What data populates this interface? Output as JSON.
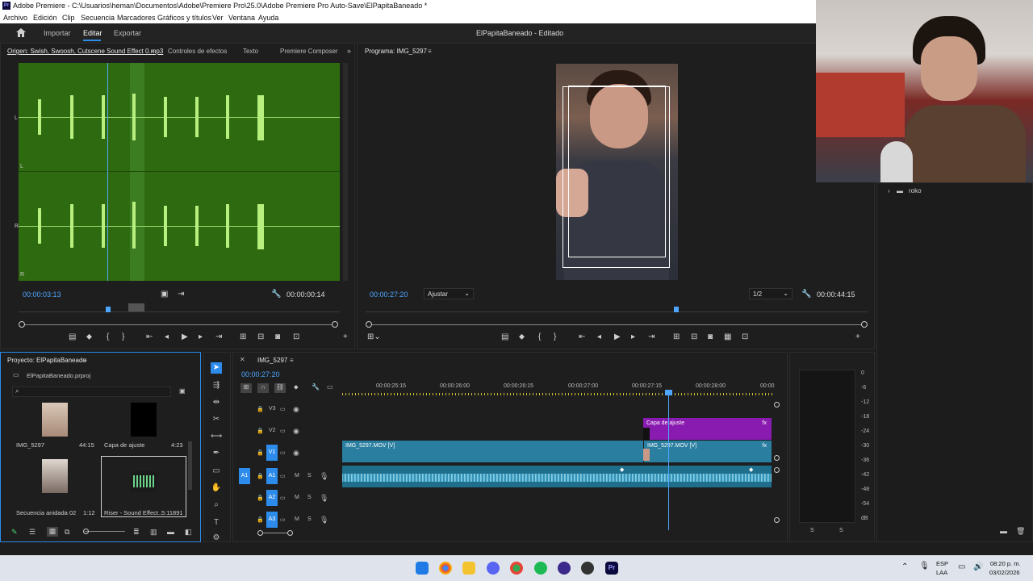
{
  "title_bar": {
    "app_title": "Adobe Premiere - C:\\Usuarios\\heman\\Documentos\\Adobe\\Premiere Pro\\25.0\\Adobe Premiere Pro Auto-Save\\ElPapitaBaneado *"
  },
  "menu": [
    "Archivo",
    "Edición",
    "Clip",
    "Secuencia",
    "Marcadores",
    "Gráficos y títulos",
    "Ver",
    "Ventana",
    "Ayuda"
  ],
  "app_header": {
    "import": "Importar",
    "edit": "Editar",
    "export": "Exportar",
    "project_title": "ElPapitaBaneado - Editado"
  },
  "source_panel": {
    "tabs": [
      "Origen: Swish, Swoosh, Cutscene Sound Effect 0.mp3",
      "Controles de efectos",
      "Texto",
      "Premiere Composer"
    ],
    "channel_labels": [
      "L",
      "L",
      "R",
      "R"
    ],
    "timecode": "00:00:03:13",
    "duration": "00:00:00:14"
  },
  "program_panel": {
    "tab": "Programa: IMG_5297",
    "timecode": "00:00:27:20",
    "fit": "Ajustar",
    "quality": "1/2",
    "duration": "00:00:44:15"
  },
  "project_panel": {
    "tab": "Proyecto: ElPapitaBaneado",
    "file": "ElPapitaBaneado.prproj",
    "items": [
      {
        "name": "IMG_5297",
        "duration": "44:15"
      },
      {
        "name": "Capa de ajuste",
        "duration": "4:23"
      },
      {
        "name": "Secuencia anidada 02",
        "duration": "1:12"
      },
      {
        "name": "Riser - Sound Effect...",
        "duration": "5:11891"
      }
    ]
  },
  "timeline": {
    "tab": "IMG_5297",
    "timecode": "00:00:27:20",
    "ruler": [
      "00:00:25:15",
      "00:00:26:00",
      "00:00:26:15",
      "00:00:27:00",
      "00:00:27:15",
      "00:00:28:00",
      "00:00"
    ],
    "tracks": [
      "V3",
      "V2",
      "V1",
      "A1",
      "A2",
      "A3"
    ],
    "source_patch_v": "V1",
    "source_patch_a": "A1",
    "clips": {
      "adjust": "Capa de ajuste",
      "v1a": "IMG_5297.MOV [V]",
      "v1b": "IMG_5297.MOV [V]",
      "fx": "fx"
    },
    "ms_labels": [
      "M",
      "S"
    ]
  },
  "meter": {
    "labels": [
      "0",
      "-6",
      "-12",
      "-18",
      "-24",
      "-30",
      "-36",
      "-42",
      "-48",
      "-54",
      "dB"
    ],
    "solo": [
      "S",
      "S"
    ]
  },
  "right_panel": {
    "folder": "roko"
  },
  "taskbar": {
    "lang_top": "ESP",
    "lang_bottom": "LAA",
    "time": "08:20 p. m.",
    "date": "03/02/2026"
  },
  "colors": {
    "accent": "#2d8ceb",
    "waveform_bg": "#2e6b10",
    "waveform_peak": "#b8f07f",
    "clip_video": "#2a7ea0",
    "clip_adjust": "#8a1bb0",
    "clip_audio": "#1f6f8c"
  }
}
